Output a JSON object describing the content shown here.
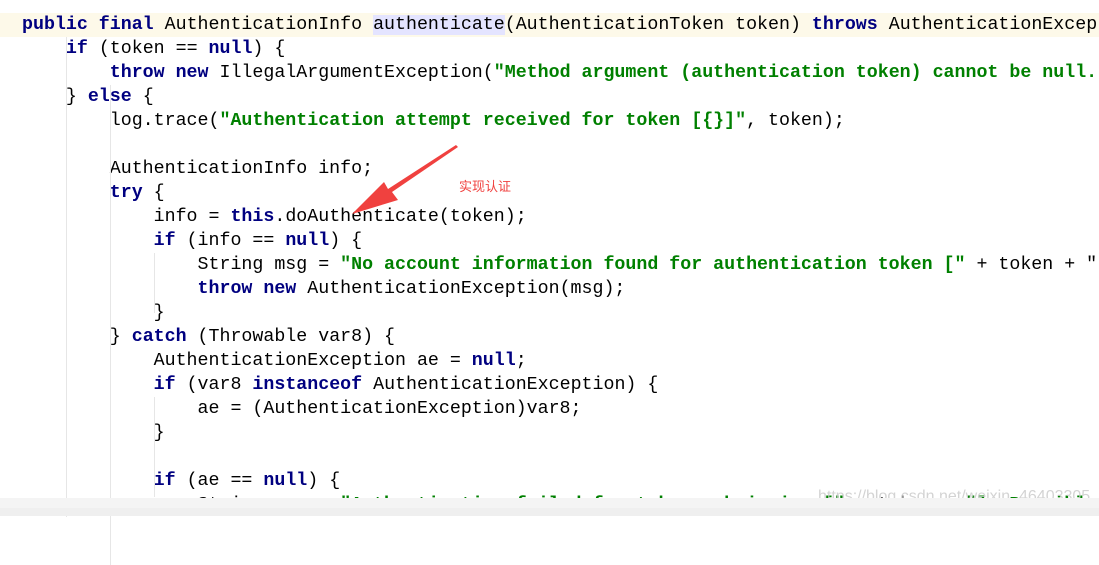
{
  "editor": {
    "colors": {
      "keyword": "#000080",
      "string": "#008000",
      "highlight": "#e4e4ff",
      "current_line": "#fdf9e9",
      "annotation": "#f0413f"
    },
    "lines": [
      [
        [
          "kw",
          "public final "
        ],
        [
          "t",
          "AuthenticationInfo "
        ],
        [
          "hl",
          "authenticate"
        ],
        [
          "t",
          "(AuthenticationToken token) "
        ],
        [
          "kw",
          "throws "
        ],
        [
          "t",
          "AuthenticationExcep"
        ]
      ],
      [
        [
          "t",
          "    "
        ],
        [
          "kw",
          "if "
        ],
        [
          "t",
          "(token == "
        ],
        [
          "kw",
          "null"
        ],
        [
          "t",
          ") {"
        ]
      ],
      [
        [
          "t",
          "        "
        ],
        [
          "kw",
          "throw new "
        ],
        [
          "t",
          "IllegalArgumentException("
        ],
        [
          "str",
          "\"Method argument (authentication token) cannot be null."
        ]
      ],
      [
        [
          "t",
          "    } "
        ],
        [
          "kw",
          "else "
        ],
        [
          "t",
          "{"
        ]
      ],
      [
        [
          "t",
          "        log.trace("
        ],
        [
          "str",
          "\"Authentication attempt received for token [{}]\""
        ],
        [
          "t",
          ", token);"
        ]
      ],
      [],
      [
        [
          "t",
          "        AuthenticationInfo info;"
        ]
      ],
      [
        [
          "t",
          "        "
        ],
        [
          "kw",
          "try "
        ],
        [
          "t",
          "{"
        ]
      ],
      [
        [
          "t",
          "            info = "
        ],
        [
          "kw",
          "this"
        ],
        [
          "t",
          ".doAuthenticate(token);"
        ]
      ],
      [
        [
          "t",
          "            "
        ],
        [
          "kw",
          "if "
        ],
        [
          "t",
          "(info == "
        ],
        [
          "kw",
          "null"
        ],
        [
          "t",
          ") {"
        ]
      ],
      [
        [
          "t",
          "                String msg = "
        ],
        [
          "str",
          "\"No account information found for authentication token [\""
        ],
        [
          "t",
          " + token + \""
        ]
      ],
      [
        [
          "t",
          "                "
        ],
        [
          "kw",
          "throw new "
        ],
        [
          "t",
          "AuthenticationException(msg);"
        ]
      ],
      [
        [
          "t",
          "            }"
        ]
      ],
      [
        [
          "t",
          "        } "
        ],
        [
          "kw",
          "catch "
        ],
        [
          "t",
          "(Throwable var8) {"
        ]
      ],
      [
        [
          "t",
          "            AuthenticationException ae = "
        ],
        [
          "kw",
          "null"
        ],
        [
          "t",
          ";"
        ]
      ],
      [
        [
          "t",
          "            "
        ],
        [
          "kw",
          "if "
        ],
        [
          "t",
          "(var8 "
        ],
        [
          "kw",
          "instanceof "
        ],
        [
          "t",
          "AuthenticationException) {"
        ]
      ],
      [
        [
          "t",
          "                ae = (AuthenticationException)var8;"
        ]
      ],
      [
        [
          "t",
          "            }"
        ]
      ],
      [],
      [
        [
          "t",
          "            "
        ],
        [
          "kw",
          "if "
        ],
        [
          "t",
          "(ae == "
        ],
        [
          "kw",
          "null"
        ],
        [
          "t",
          ") {"
        ]
      ],
      [
        [
          "t",
          "                String msg = "
        ],
        [
          "str",
          "\"Authentication failed for token submission [\""
        ],
        [
          "t",
          " + token + "
        ],
        [
          "str",
          "\"]. Possibl"
        ]
      ]
    ]
  },
  "annotation": {
    "text": "实现认证",
    "arrow_icon": "red-arrow"
  },
  "watermark": "https://blog.csdn.net/weixin_46403305"
}
